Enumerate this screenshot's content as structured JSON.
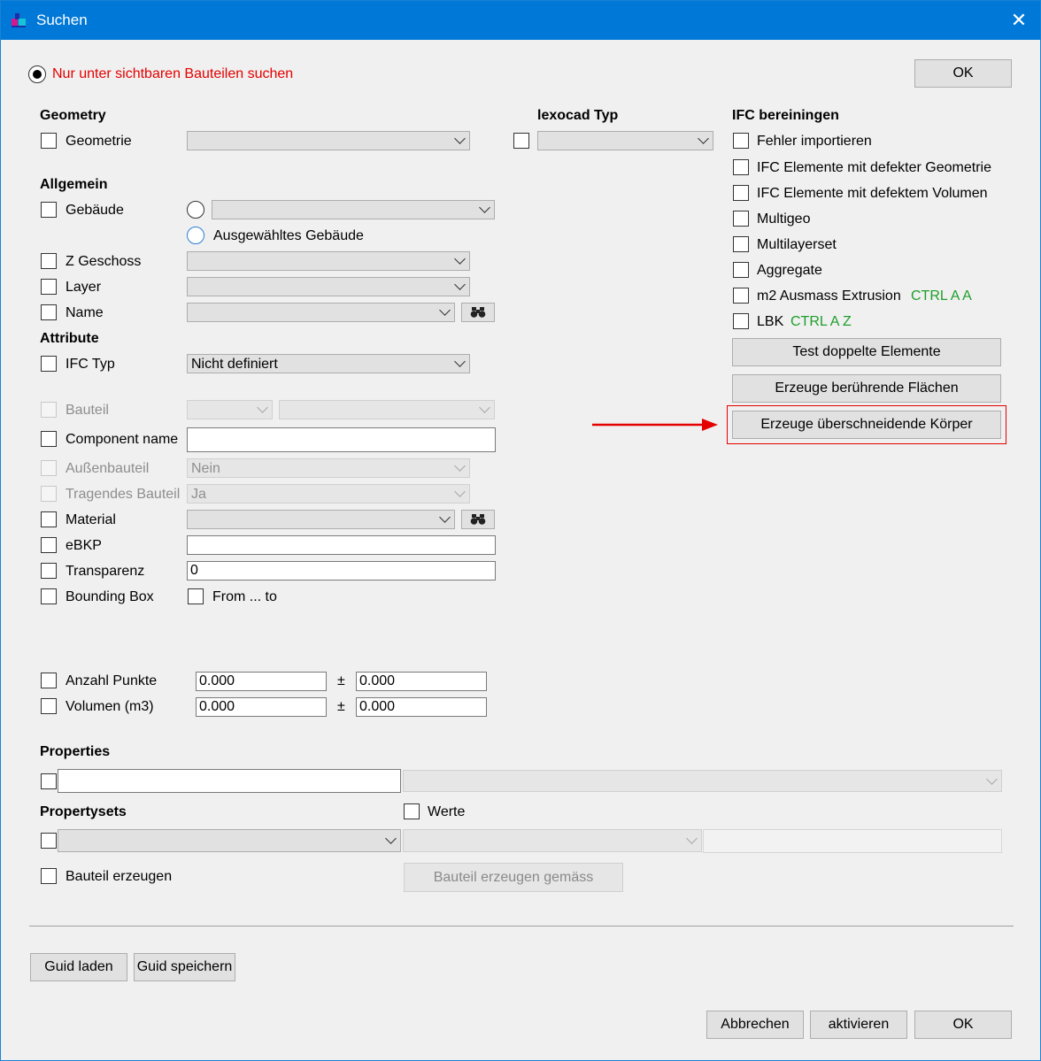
{
  "window": {
    "title": "Suchen",
    "close_glyph": "✕"
  },
  "top": {
    "visible_only_label": "Nur unter sichtbaren Bauteilen suchen",
    "ok_label": "OK"
  },
  "geometry": {
    "heading": "Geometry",
    "geometrie_label": "Geometrie"
  },
  "lexocad": {
    "heading": "lexocad Typ"
  },
  "allgemein": {
    "heading": "Allgemein",
    "gebaeude_label": "Gebäude",
    "selected_building_label": "Ausgewähltes Gebäude",
    "z_geschoss_label": "Z Geschoss",
    "layer_label": "Layer",
    "name_label": "Name"
  },
  "attribute": {
    "heading": "Attribute",
    "ifc_typ_label": "IFC Typ",
    "ifc_typ_value": "Nicht definiert",
    "bauteil_label": "Bauteil",
    "component_name_label": "Component name",
    "aussenbauteil_label": "Außenbauteil",
    "aussenbauteil_value": "Nein",
    "tragendes_label": "Tragendes Bauteil",
    "tragendes_value": "Ja",
    "material_label": "Material",
    "ebkp_label": "eBKP",
    "transparenz_label": "Transparenz",
    "transparenz_value": "0",
    "bbox_label": "Bounding Box",
    "from_to_label": "From ... to"
  },
  "counts": {
    "anzahl_label": "Anzahl Punkte",
    "anzahl_value": "0.000",
    "anzahl_tol": "0.000",
    "volumen_label": "Volumen (m3)",
    "volumen_value": "0.000",
    "volumen_tol": "0.000",
    "pm": "±"
  },
  "properties": {
    "heading": "Properties"
  },
  "propertysets": {
    "heading": "Propertysets",
    "werte_label": "Werte"
  },
  "bauteil_erzeugen": {
    "label": "Bauteil erzeugen",
    "button_label": "Bauteil erzeugen gemäss"
  },
  "ifc": {
    "heading": "IFC bereiningen",
    "items": [
      "Fehler importieren",
      "IFC Elemente mit defekter Geometrie",
      "IFC Elemente mit defektem Volumen",
      "Multigeo",
      "Multilayerset",
      "Aggregate",
      "m2 Ausmass Extrusion",
      "LBK"
    ],
    "shortcut_m2": "CTRL A A",
    "shortcut_lbk": "CTRL A Z",
    "btn_test": "Test doppelte Elemente",
    "btn_flaechen": "Erzeuge berührende Flächen",
    "btn_koerper": "Erzeuge überschneidende Körper"
  },
  "bottom": {
    "guid_laden": "Guid laden",
    "guid_speichern": "Guid speichern",
    "abbrechen": "Abbrechen",
    "aktivieren": "aktivieren",
    "ok": "OK"
  },
  "colors": {
    "title_bar": "#0078d7",
    "highlight": "#e50000",
    "shortcut": "#1e9e2a"
  },
  "icons": {
    "binoculars": "binoculars-icon",
    "app": "app-icon"
  }
}
